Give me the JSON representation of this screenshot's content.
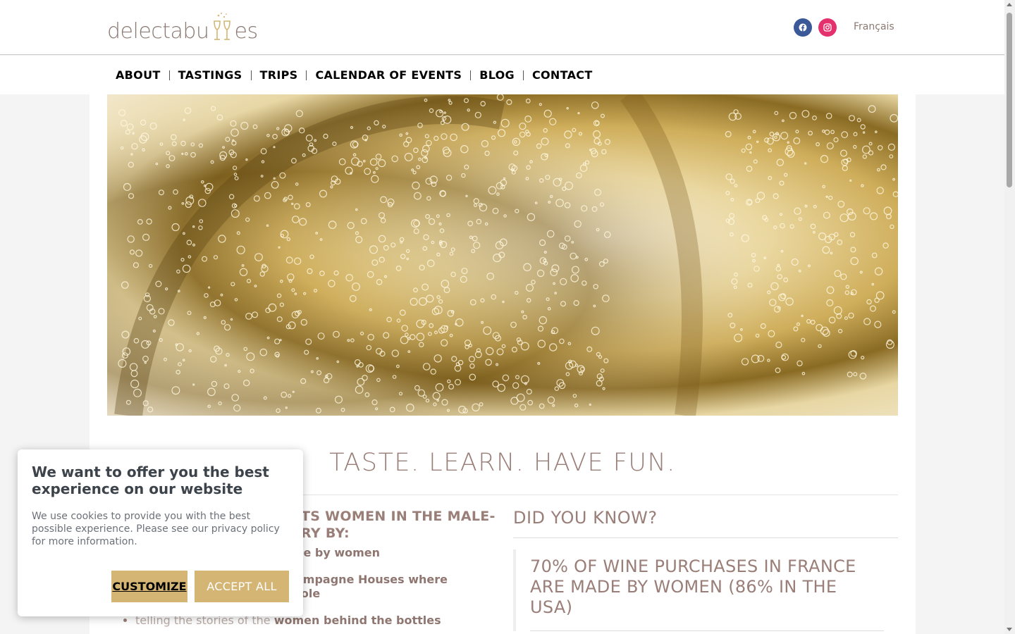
{
  "header": {
    "logo_text_start": "delectabu",
    "logo_text_end": "es",
    "language_link": "Français",
    "social": [
      {
        "icon": "facebook-icon",
        "color": "#3b5998"
      },
      {
        "icon": "instagram-icon",
        "color": "#e4306c"
      }
    ]
  },
  "nav": {
    "items": [
      "ABOUT",
      "TASTINGS",
      "TRIPS",
      "CALENDAR OF EVENTS",
      "BLOG",
      "CONTACT"
    ]
  },
  "main": {
    "tagline": "TASTE. LEARN. HAVE FUN.",
    "left_heading": "TS WOMEN IN THE MALE-\nRY BY:",
    "list": [
      {
        "bold": "de by women"
      },
      {
        "bold": "ampagne Houses where\nrole"
      },
      {
        "light": "telling the stories of the",
        "bold": "women behind the bottles"
      }
    ],
    "did_you_know": "DID YOU KNOW?",
    "fact": "70% OF WINE PURCHASES IN FRANCE ARE MADE BY WOMEN (86% IN THE USA)"
  },
  "cookie": {
    "title": "We want to offer you the best experience on our website",
    "text": "We use cookies to provide you with the best possible experience. Please see our privacy policy for more information.",
    "customize_label": "CUSTOMIZE",
    "accept_label": "ACCEPT ALL"
  },
  "colors": {
    "brand_text": "#9a7e78",
    "button_gold": "#d4b574"
  }
}
